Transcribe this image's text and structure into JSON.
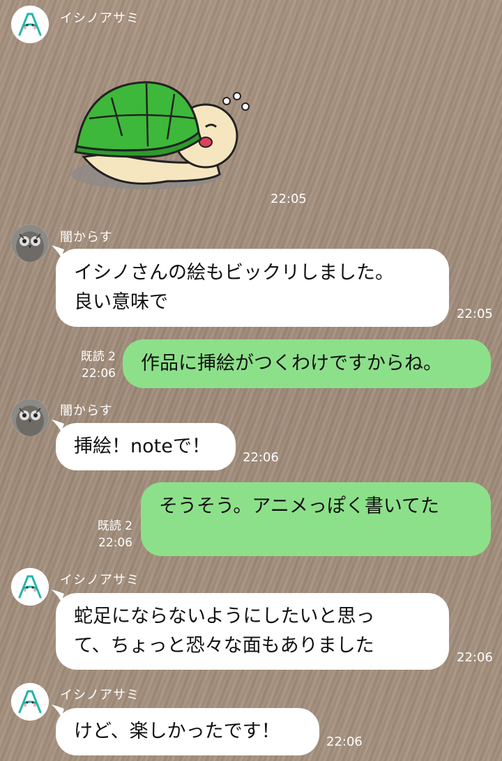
{
  "messages": [
    {
      "sender": "イシノアサミ",
      "type": "sticker",
      "time": "22:05"
    },
    {
      "sender": "闇からす",
      "lines": [
        "イシノさんの絵もビックリしました。",
        "良い意味で"
      ],
      "time": "22:05"
    },
    {
      "sender": "me",
      "lines": [
        "作品に挿絵がつくわけですからね。"
      ],
      "read": "既読 2",
      "time": "22:06"
    },
    {
      "sender": "闇からす",
      "lines": [
        "挿絵！noteで！"
      ],
      "time": "22:06"
    },
    {
      "sender": "me",
      "lines": [
        "そうそう。アニメっぽく書いてた"
      ],
      "read": "既読 2",
      "time": "22:06"
    },
    {
      "sender": "イシノアサミ",
      "lines": [
        "蛇足にならないようにしたいと思っ",
        "て、ちょっと恐々な面もありました"
      ],
      "time": "22:06"
    },
    {
      "sender": "イシノアサミ",
      "lines": [
        "けど、楽しかったです！"
      ],
      "time": "22:06"
    }
  ],
  "colors": {
    "incoming_bubble": "#ffffff",
    "outgoing_bubble": "#8de08a",
    "background": "#a38e7c"
  },
  "icons": {
    "ishino_avatar": "logo-a-face",
    "karasu_avatar": "owl-photo",
    "sticker": "turtle-sticker"
  }
}
